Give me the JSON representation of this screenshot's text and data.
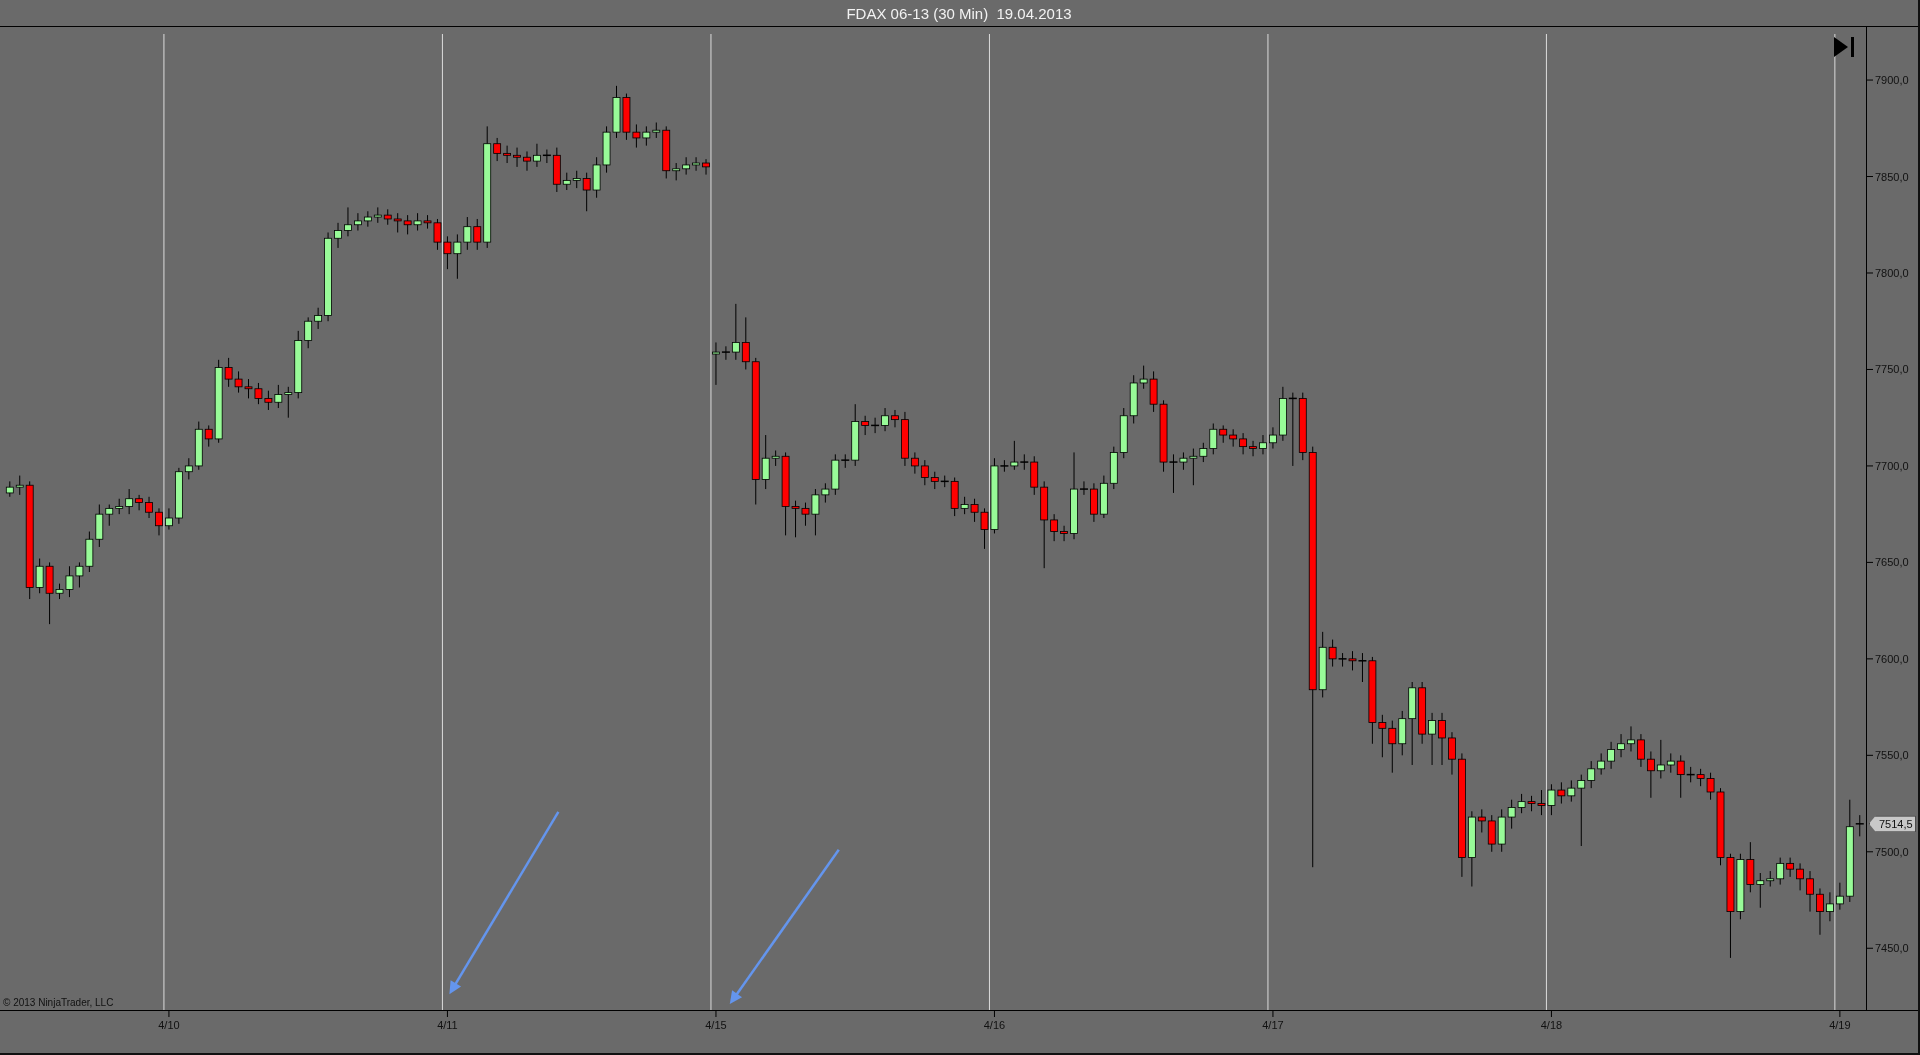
{
  "window": {
    "title": "FDAX 06-13 (30 Min)  19.04.2013"
  },
  "chart": {
    "chart_data": {
      "type": "candlestick",
      "categories": [
        null,
        null,
        null,
        null,
        null,
        null,
        null,
        null,
        null,
        null,
        null,
        null,
        null,
        null,
        null,
        null,
        "4/10",
        null,
        null,
        null,
        null,
        null,
        null,
        null,
        null,
        null,
        null,
        null,
        null,
        null,
        null,
        null,
        null,
        null,
        null,
        null,
        null,
        null,
        null,
        null,
        null,
        null,
        null,
        null,
        "4/11",
        null,
        null,
        null,
        null,
        null,
        null,
        null,
        null,
        null,
        null,
        null,
        null,
        null,
        null,
        null,
        null,
        null,
        null,
        null,
        null,
        null,
        null,
        null,
        null,
        null,
        null,
        "4/15",
        null,
        null,
        null,
        null,
        null,
        null,
        null,
        null,
        null,
        null,
        null,
        null,
        null,
        null,
        null,
        null,
        null,
        null,
        null,
        null,
        null,
        null,
        null,
        null,
        null,
        null,
        null,
        "4/16",
        null,
        null,
        null,
        null,
        null,
        null,
        null,
        null,
        null,
        null,
        null,
        null,
        null,
        null,
        null,
        null,
        null,
        null,
        null,
        null,
        null,
        null,
        null,
        null,
        null,
        null,
        null,
        "4/17",
        null,
        null,
        null,
        null,
        null,
        null,
        null,
        null,
        null,
        null,
        null,
        null,
        null,
        null,
        null,
        null,
        null,
        null,
        null,
        null,
        null,
        null,
        null,
        null,
        null,
        null,
        null,
        "4/18",
        null,
        null,
        null,
        null,
        null,
        null,
        null,
        null,
        null,
        null,
        null,
        null,
        null,
        null,
        null,
        null,
        null,
        null,
        null,
        null,
        null,
        null,
        null,
        null,
        null,
        null,
        null,
        null,
        "4/19",
        null,
        null
      ],
      "ohlc": [
        [
          7686,
          7692,
          7684,
          7689
        ],
        [
          7689,
          7695,
          7685,
          7690
        ],
        [
          7690,
          7692,
          7631,
          7637
        ],
        [
          7637,
          7652,
          7634,
          7648
        ],
        [
          7648,
          7650,
          7618,
          7634
        ],
        [
          7634,
          7639,
          7631,
          7636
        ],
        [
          7636,
          7648,
          7632,
          7643
        ],
        [
          7643,
          7650,
          7637,
          7648
        ],
        [
          7648,
          7666,
          7645,
          7662
        ],
        [
          7662,
          7680,
          7658,
          7675
        ],
        [
          7675,
          7680,
          7669,
          7678
        ],
        [
          7678,
          7683,
          7675,
          7679
        ],
        [
          7679,
          7688,
          7675,
          7683
        ],
        [
          7683,
          7685,
          7677,
          7681
        ],
        [
          7681,
          7684,
          7673,
          7676
        ],
        [
          7676,
          7678,
          7664,
          7669
        ],
        [
          7669,
          7678,
          7667,
          7673
        ],
        [
          7673,
          7699,
          7670,
          7697
        ],
        [
          7697,
          7704,
          7693,
          7700
        ],
        [
          7700,
          7723,
          7698,
          7719
        ],
        [
          7719,
          7721,
          7710,
          7714
        ],
        [
          7714,
          7755,
          7712,
          7751
        ],
        [
          7751,
          7756,
          7741,
          7745
        ],
        [
          7745,
          7749,
          7738,
          7741
        ],
        [
          7741,
          7745,
          7735,
          7740
        ],
        [
          7740,
          7743,
          7732,
          7735
        ],
        [
          7735,
          7739,
          7729,
          7733
        ],
        [
          7733,
          7742,
          7730,
          7737
        ],
        [
          7737,
          7741,
          7725,
          7738
        ],
        [
          7738,
          7770,
          7735,
          7765
        ],
        [
          7765,
          7777,
          7761,
          7775
        ],
        [
          7775,
          7782,
          7771,
          7778
        ],
        [
          7778,
          7821,
          7775,
          7818
        ],
        [
          7818,
          7826,
          7813,
          7822
        ],
        [
          7822,
          7834,
          7819,
          7825
        ],
        [
          7825,
          7831,
          7822,
          7827
        ],
        [
          7827,
          7832,
          7824,
          7829
        ],
        [
          7829,
          7834,
          7826,
          7830
        ],
        [
          7830,
          7833,
          7825,
          7828
        ],
        [
          7828,
          7831,
          7821,
          7827
        ],
        [
          7827,
          7830,
          7820,
          7825
        ],
        [
          7825,
          7831,
          7822,
          7827
        ],
        [
          7827,
          7830,
          7823,
          7826
        ],
        [
          7826,
          7828,
          7812,
          7816
        ],
        [
          7816,
          7819,
          7802,
          7810
        ],
        [
          7810,
          7820,
          7797,
          7816
        ],
        [
          7816,
          7829,
          7812,
          7824
        ],
        [
          7824,
          7828,
          7812,
          7816
        ],
        [
          7816,
          7876,
          7813,
          7867
        ],
        [
          7867,
          7870,
          7858,
          7862
        ],
        [
          7862,
          7866,
          7857,
          7861
        ],
        [
          7861,
          7865,
          7855,
          7860
        ],
        [
          7860,
          7863,
          7853,
          7858
        ],
        [
          7858,
          7867,
          7855,
          7861
        ],
        [
          7861,
          7864,
          7857,
          7861
        ],
        [
          7861,
          7865,
          7842,
          7846
        ],
        [
          7846,
          7852,
          7843,
          7848
        ],
        [
          7848,
          7853,
          7844,
          7849
        ],
        [
          7849,
          7852,
          7832,
          7843
        ],
        [
          7843,
          7860,
          7839,
          7856
        ],
        [
          7856,
          7876,
          7852,
          7873
        ],
        [
          7873,
          7897,
          7870,
          7891
        ],
        [
          7891,
          7893,
          7869,
          7873
        ],
        [
          7873,
          7877,
          7865,
          7870
        ],
        [
          7870,
          7876,
          7866,
          7873
        ],
        [
          7873,
          7878,
          7870,
          7874
        ],
        [
          7874,
          7876,
          7849,
          7853
        ],
        [
          7853,
          7857,
          7848,
          7854
        ],
        [
          7854,
          7860,
          7851,
          7856
        ],
        [
          7856,
          7860,
          7853,
          7857
        ],
        [
          7857,
          7859,
          7851,
          7855
        ],
        [
          7758,
          7764,
          7742,
          7759
        ],
        [
          7759,
          7762,
          7755,
          7759
        ],
        [
          7759,
          7784,
          7755,
          7764
        ],
        [
          7764,
          7777,
          7750,
          7754
        ],
        [
          7754,
          7756,
          7680,
          7693
        ],
        [
          7693,
          7716,
          7688,
          7704
        ],
        [
          7704,
          7708,
          7700,
          7705
        ],
        [
          7705,
          7707,
          7664,
          7679
        ],
        [
          7679,
          7682,
          7663,
          7678
        ],
        [
          7678,
          7681,
          7669,
          7675
        ],
        [
          7675,
          7688,
          7664,
          7685
        ],
        [
          7685,
          7691,
          7681,
          7688
        ],
        [
          7688,
          7706,
          7685,
          7703
        ],
        [
          7703,
          7706,
          7699,
          7703
        ],
        [
          7703,
          7732,
          7700,
          7723
        ],
        [
          7723,
          7726,
          7716,
          7721
        ],
        [
          7721,
          7725,
          7717,
          7721
        ],
        [
          7721,
          7730,
          7718,
          7726
        ],
        [
          7726,
          7729,
          7720,
          7724
        ],
        [
          7724,
          7728,
          7700,
          7704
        ],
        [
          7704,
          7707,
          7696,
          7700
        ],
        [
          7700,
          7703,
          7690,
          7694
        ],
        [
          7694,
          7697,
          7688,
          7692
        ],
        [
          7692,
          7695,
          7689,
          7692
        ],
        [
          7692,
          7694,
          7674,
          7678
        ],
        [
          7678,
          7684,
          7675,
          7680
        ],
        [
          7680,
          7683,
          7671,
          7676
        ],
        [
          7676,
          7678,
          7657,
          7667
        ],
        [
          7667,
          7704,
          7665,
          7700
        ],
        [
          7700,
          7703,
          7697,
          7700
        ],
        [
          7700,
          7713,
          7698,
          7702
        ],
        [
          7702,
          7706,
          7698,
          7702
        ],
        [
          7702,
          7705,
          7685,
          7689
        ],
        [
          7689,
          7692,
          7647,
          7672
        ],
        [
          7672,
          7675,
          7661,
          7666
        ],
        [
          7666,
          7669,
          7661,
          7665
        ],
        [
          7665,
          7707,
          7662,
          7688
        ],
        [
          7688,
          7692,
          7685,
          7688
        ],
        [
          7688,
          7691,
          7671,
          7675
        ],
        [
          7675,
          7695,
          7673,
          7691
        ],
        [
          7691,
          7710,
          7688,
          7707
        ],
        [
          7707,
          7730,
          7704,
          7726
        ],
        [
          7726,
          7747,
          7722,
          7743
        ],
        [
          7743,
          7752,
          7740,
          7745
        ],
        [
          7745,
          7749,
          7728,
          7732
        ],
        [
          7732,
          7734,
          7697,
          7702
        ],
        [
          7702,
          7706,
          7686,
          7702
        ],
        [
          7702,
          7707,
          7698,
          7704
        ],
        [
          7704,
          7709,
          7690,
          7705
        ],
        [
          7705,
          7712,
          7702,
          7709
        ],
        [
          7709,
          7722,
          7706,
          7719
        ],
        [
          7719,
          7721,
          7712,
          7716
        ],
        [
          7716,
          7719,
          7710,
          7714
        ],
        [
          7714,
          7717,
          7706,
          7710
        ],
        [
          7710,
          7713,
          7705,
          7709
        ],
        [
          7709,
          7716,
          7706,
          7712
        ],
        [
          7712,
          7720,
          7709,
          7716
        ],
        [
          7716,
          7741,
          7713,
          7735
        ],
        [
          7735,
          7738,
          7700,
          7735
        ],
        [
          7735,
          7738,
          7703,
          7707
        ],
        [
          7707,
          7710,
          7492,
          7584
        ],
        [
          7584,
          7614,
          7580,
          7606
        ],
        [
          7606,
          7610,
          7596,
          7600
        ],
        [
          7600,
          7603,
          7596,
          7600
        ],
        [
          7600,
          7604,
          7594,
          7599
        ],
        [
          7599,
          7603,
          7588,
          7599
        ],
        [
          7599,
          7601,
          7556,
          7567
        ],
        [
          7567,
          7571,
          7549,
          7564
        ],
        [
          7564,
          7568,
          7541,
          7556
        ],
        [
          7556,
          7573,
          7550,
          7569
        ],
        [
          7569,
          7588,
          7545,
          7585
        ],
        [
          7585,
          7588,
          7556,
          7561
        ],
        [
          7561,
          7572,
          7545,
          7568
        ],
        [
          7568,
          7572,
          7545,
          7559
        ],
        [
          7559,
          7562,
          7540,
          7548
        ],
        [
          7548,
          7551,
          7487,
          7497
        ],
        [
          7497,
          7521,
          7482,
          7518
        ],
        [
          7518,
          7522,
          7510,
          7516
        ],
        [
          7516,
          7519,
          7500,
          7504
        ],
        [
          7504,
          7522,
          7500,
          7518
        ],
        [
          7518,
          7527,
          7512,
          7523
        ],
        [
          7523,
          7530,
          7520,
          7526
        ],
        [
          7526,
          7529,
          7521,
          7525
        ],
        [
          7525,
          7532,
          7519,
          7524
        ],
        [
          7524,
          7535,
          7519,
          7532
        ],
        [
          7532,
          7536,
          7525,
          7529
        ],
        [
          7529,
          7537,
          7526,
          7533
        ],
        [
          7533,
          7540,
          7503,
          7537
        ],
        [
          7537,
          7547,
          7533,
          7543
        ],
        [
          7543,
          7551,
          7540,
          7547
        ],
        [
          7547,
          7557,
          7543,
          7553
        ],
        [
          7553,
          7561,
          7549,
          7556
        ],
        [
          7556,
          7565,
          7552,
          7558
        ],
        [
          7558,
          7561,
          7544,
          7548
        ],
        [
          7548,
          7552,
          7528,
          7542
        ],
        [
          7542,
          7558,
          7538,
          7545
        ],
        [
          7545,
          7551,
          7541,
          7547
        ],
        [
          7547,
          7550,
          7528,
          7540
        ],
        [
          7540,
          7544,
          7536,
          7540
        ],
        [
          7540,
          7543,
          7534,
          7538
        ],
        [
          7538,
          7541,
          7527,
          7531
        ],
        [
          7531,
          7533,
          7493,
          7497
        ],
        [
          7497,
          7499,
          7445,
          7469
        ],
        [
          7469,
          7499,
          7465,
          7496
        ],
        [
          7496,
          7505,
          7479,
          7483
        ],
        [
          7483,
          7489,
          7471,
          7485
        ],
        [
          7485,
          7490,
          7482,
          7486
        ],
        [
          7486,
          7497,
          7483,
          7494
        ],
        [
          7494,
          7497,
          7487,
          7491
        ],
        [
          7491,
          7494,
          7480,
          7486
        ],
        [
          7486,
          7490,
          7469,
          7478
        ],
        [
          7478,
          7481,
          7457,
          7469
        ],
        [
          7469,
          7479,
          7464,
          7473
        ],
        [
          7473,
          7484,
          7470,
          7477
        ],
        [
          7477,
          7527,
          7474,
          7513
        ],
        [
          7514,
          7519,
          7508,
          7514.5
        ]
      ],
      "ylim": [
        7418,
        7927.5
      ],
      "yticks": [
        {
          "value": 7900,
          "label": "7900,0"
        },
        {
          "value": 7850,
          "label": "7850,0"
        },
        {
          "value": 7800,
          "label": "7800,0"
        },
        {
          "value": 7750,
          "label": "7750,0"
        },
        {
          "value": 7700,
          "label": "7700,0"
        },
        {
          "value": 7650,
          "label": "7650,0"
        },
        {
          "value": 7600,
          "label": "7600,0"
        },
        {
          "value": 7550,
          "label": "7550,0"
        },
        {
          "value": 7500,
          "label": "7500,0"
        },
        {
          "value": 7450,
          "label": "7450,0"
        }
      ]
    },
    "last_price": "7514,5",
    "copyright": "© 2013 NinjaTrader, LLC"
  }
}
